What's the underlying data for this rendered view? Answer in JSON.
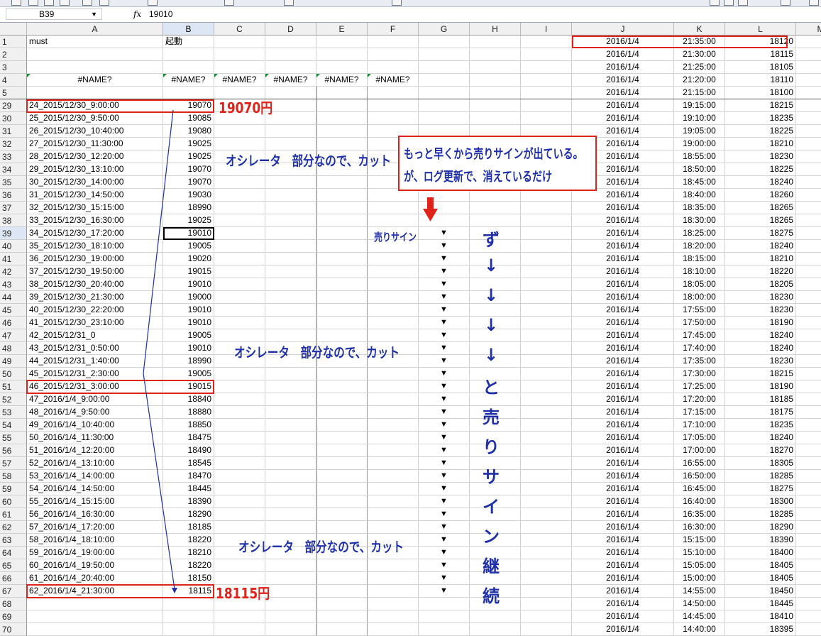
{
  "formula_bar": {
    "name_box": "B39",
    "fx": "fx",
    "formula": "19010"
  },
  "columns": [
    "A",
    "B",
    "C",
    "D",
    "E",
    "F",
    "G",
    "H",
    "I",
    "J",
    "K",
    "L",
    "M"
  ],
  "selected_column": "B",
  "selected_row": "39",
  "row_labels": [
    "1",
    "2",
    "3",
    "4",
    "5",
    "29",
    "30",
    "31",
    "32",
    "33",
    "34",
    "35",
    "36",
    "37",
    "38",
    "39",
    "40",
    "41",
    "42",
    "43",
    "44",
    "45",
    "46",
    "47",
    "48",
    "49",
    "50",
    "51",
    "52",
    "53",
    "54",
    "55",
    "56",
    "57",
    "58",
    "59",
    "60",
    "61",
    "62",
    "63",
    "64",
    "65",
    "66",
    "67",
    "68",
    "69",
    "70"
  ],
  "header_cells": {
    "a1": "must",
    "b1": "起動",
    "name_errors": [
      "#NAME?",
      "#NAME?",
      "#NAME?",
      "#NAME?",
      "#NAME?",
      "#NAME?"
    ]
  },
  "colA": [
    "24_2015/12/30_9:00:00",
    "25_2015/12/30_9:50:00",
    "26_2015/12/30_10:40:00",
    "27_2015/12/30_11:30:00",
    "28_2015/12/30_12:20:00",
    "29_2015/12/30_13:10:00",
    "30_2015/12/30_14:00:00",
    "31_2015/12/30_14:50:00",
    "32_2015/12/30_15:15:00",
    "33_2015/12/30_16:30:00",
    "34_2015/12/30_17:20:00",
    "35_2015/12/30_18:10:00",
    "36_2015/12/30_19:00:00",
    "37_2015/12/30_19:50:00",
    "38_2015/12/30_20:40:00",
    "39_2015/12/30_21:30:00",
    "40_2015/12/30_22:20:00",
    "41_2015/12/30_23:10:00",
    "42_2015/12/31_0",
    "43_2015/12/31_0:50:00",
    "44_2015/12/31_1:40:00",
    "45_2015/12/31_2:30:00",
    "46_2015/12/31_3:00:00",
    "47_2016/1/4_9:00:00",
    "48_2016/1/4_9:50:00",
    "49_2016/1/4_10:40:00",
    "50_2016/1/4_11:30:00",
    "51_2016/1/4_12:20:00",
    "52_2016/1/4_13:10:00",
    "53_2016/1/4_14:00:00",
    "54_2016/1/4_14:50:00",
    "55_2016/1/4_15:15:00",
    "56_2016/1/4_16:30:00",
    "57_2016/1/4_17:20:00",
    "58_2016/1/4_18:10:00",
    "59_2016/1/4_19:00:00",
    "60_2016/1/4_19:50:00",
    "61_2016/1/4_20:40:00",
    "62_2016/1/4_21:30:00"
  ],
  "colB": [
    "19070",
    "19085",
    "19080",
    "19025",
    "19025",
    "19070",
    "19070",
    "19030",
    "18990",
    "19025",
    "19010",
    "19005",
    "19020",
    "19015",
    "19010",
    "19000",
    "19010",
    "19010",
    "19005",
    "19010",
    "18990",
    "19005",
    "19015",
    "18840",
    "18880",
    "18850",
    "18475",
    "18490",
    "18545",
    "18470",
    "18445",
    "18390",
    "18290",
    "18185",
    "18220",
    "18210",
    "18220",
    "18150",
    "18115"
  ],
  "colJ": "2016/1/4",
  "colK": [
    "21:35:00",
    "21:30:00",
    "21:25:00",
    "21:20:00",
    "21:15:00",
    "19:15:00",
    "19:10:00",
    "19:05:00",
    "19:00:00",
    "18:55:00",
    "18:50:00",
    "18:45:00",
    "18:40:00",
    "18:35:00",
    "18:30:00",
    "18:25:00",
    "18:20:00",
    "18:15:00",
    "18:10:00",
    "18:05:00",
    "18:00:00",
    "17:55:00",
    "17:50:00",
    "17:45:00",
    "17:40:00",
    "17:35:00",
    "17:30:00",
    "17:25:00",
    "17:20:00",
    "17:15:00",
    "17:10:00",
    "17:05:00",
    "17:00:00",
    "16:55:00",
    "16:50:00",
    "16:45:00",
    "16:40:00",
    "16:35:00",
    "16:30:00",
    "15:15:00",
    "15:10:00",
    "15:05:00",
    "15:00:00",
    "14:55:00",
    "14:50:00",
    "14:45:00",
    "14:40:00"
  ],
  "colL": [
    "18120",
    "18115",
    "18105",
    "18110",
    "18100",
    "18215",
    "18235",
    "18225",
    "18210",
    "18230",
    "18225",
    "18240",
    "18260",
    "18265",
    "18265",
    "18275",
    "18240",
    "18210",
    "18220",
    "18205",
    "18230",
    "18230",
    "18190",
    "18240",
    "18240",
    "18230",
    "18215",
    "18190",
    "18185",
    "18175",
    "18235",
    "18240",
    "18270",
    "18305",
    "18285",
    "18275",
    "18300",
    "18285",
    "18290",
    "18390",
    "18400",
    "18405",
    "18405",
    "18450",
    "18445",
    "18410",
    "18395"
  ],
  "sell_marker": "▼",
  "annotations": {
    "price_start": "19070円",
    "price_end": "18115円",
    "cut_note": "オシレータ　部分なので、カット",
    "note_line1": "もっと早くから売りサインが出ている。",
    "note_line2": "が、ログ更新で、消えているだけ",
    "sell_sign": "売りサイン",
    "vertical": [
      "ず",
      "↓",
      "↓",
      "↓",
      "↓",
      "と",
      "売",
      "り",
      "サ",
      "イ",
      "ン",
      "継",
      "続"
    ]
  },
  "colors": {
    "annotation_red": "#e0231a",
    "annotation_blue": "#1f2fa6",
    "header_bg": "#f0f0f0",
    "selected_header_bg": "#dce6f4"
  }
}
